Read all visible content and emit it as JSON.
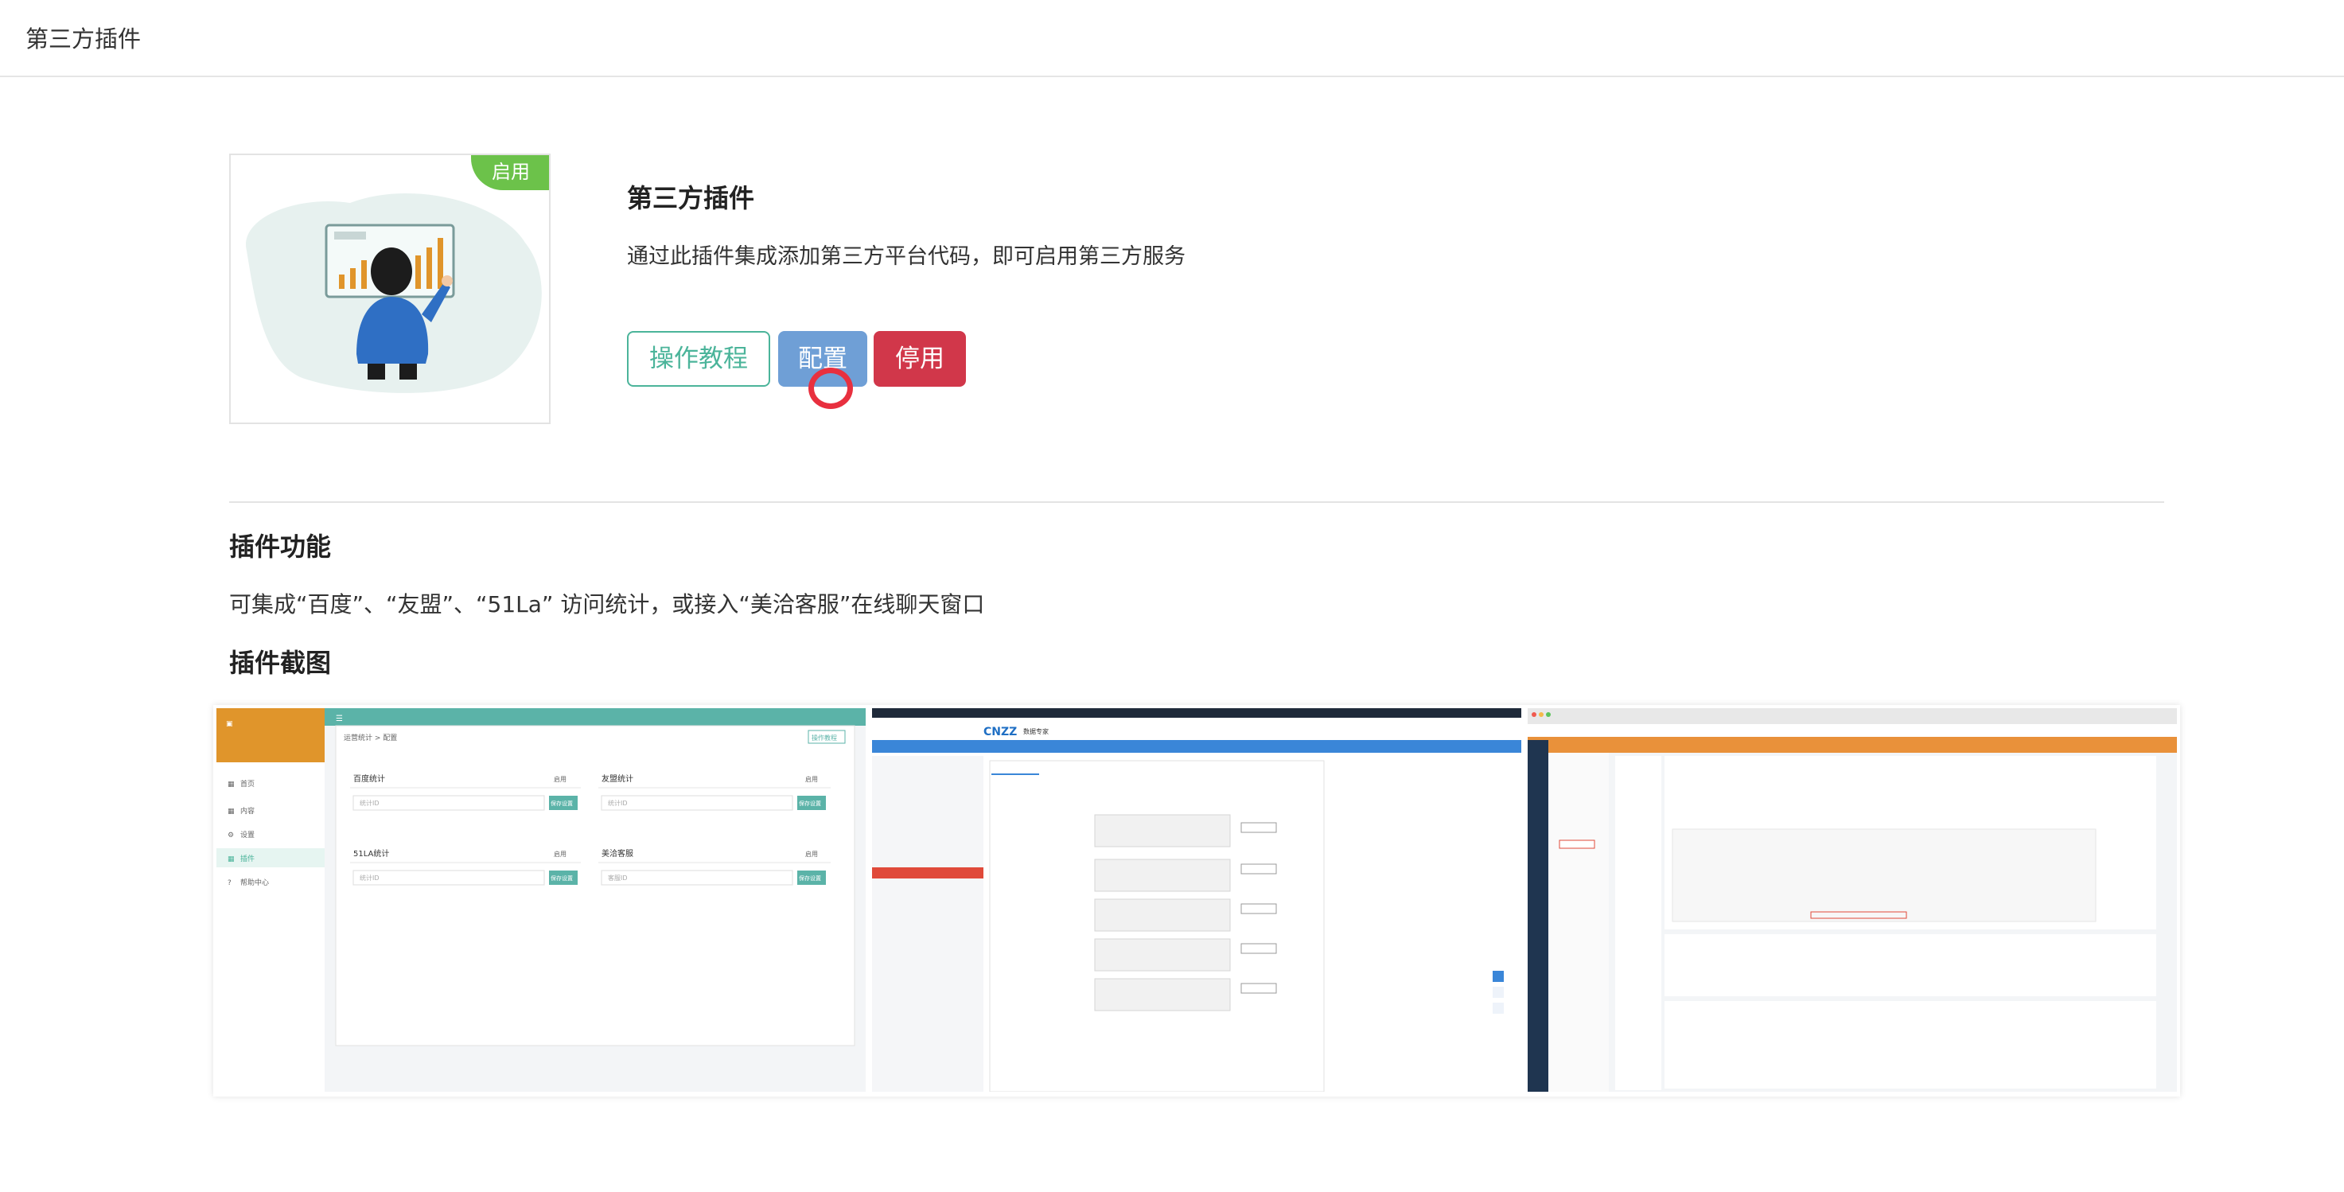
{
  "header": {
    "title": "第三方插件"
  },
  "plugin": {
    "status_badge": "启用",
    "name": "第三方插件",
    "description": "通过此插件集成添加第三方平台代码，即可启用第三方服务",
    "buttons": {
      "tutorial": "操作教程",
      "config": "配置",
      "disable": "停用"
    }
  },
  "features": {
    "title": "插件功能",
    "text": "可集成“百度”、“友盟”、“51La” 访问统计，或接入“美洽客服”在线聊天窗口"
  },
  "screenshots": {
    "title": "插件截图",
    "shot1": {
      "sidebar": [
        "首页",
        "内容",
        "设置",
        "插件",
        "帮助中心"
      ],
      "breadcrumb": "运营统计 > 配置",
      "help": "操作教程",
      "panels": [
        {
          "title": "百度统计",
          "toggle": "启用",
          "placeholder": "统计ID",
          "save": "保存设置"
        },
        {
          "title": "友盟统计",
          "toggle": "启用",
          "placeholder": "统计ID",
          "save": "保存设置"
        },
        {
          "title": "51LA统计",
          "toggle": "启用",
          "placeholder": "统计ID",
          "save": "保存设置"
        },
        {
          "title": "美洽客服",
          "toggle": "启用",
          "placeholder": "客服ID",
          "save": "保存设置"
        }
      ]
    },
    "shot2": {
      "logo": "CNZZ",
      "logo_sub": "数据专家"
    }
  },
  "colors": {
    "enabled_badge": "#6cc24a",
    "tutorial_button": "#4bb49a",
    "config_button": "#6f9fd6",
    "disable_button": "#d1374a",
    "cursor_ring": "#e8303f"
  }
}
